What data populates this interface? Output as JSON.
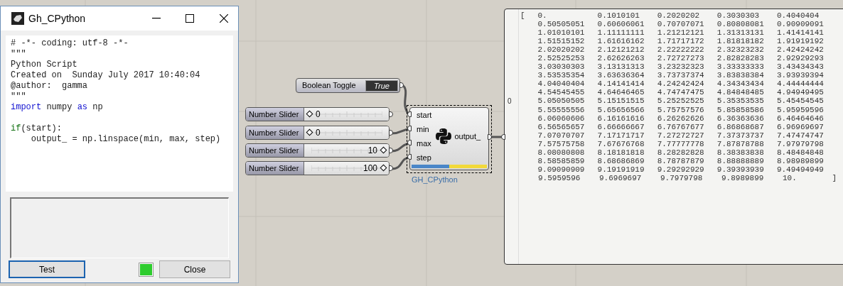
{
  "editor": {
    "title": "Gh_CPython",
    "code_lines": [
      [
        {
          "text": "# -*- coding: utf-8 -*-",
          "kind": "plain"
        }
      ],
      [
        {
          "text": "\"\"\"",
          "kind": "plain"
        }
      ],
      [
        {
          "text": "Python Script",
          "kind": "plain"
        }
      ],
      [
        {
          "text": "Created on  Sunday July 2017 10:40:04",
          "kind": "plain"
        }
      ],
      [
        {
          "text": "@author:  gamma",
          "kind": "plain"
        }
      ],
      [
        {
          "text": "\"\"\"",
          "kind": "plain"
        }
      ],
      [
        {
          "text": "import",
          "kind": "keyword"
        },
        {
          "text": " numpy ",
          "kind": "plain"
        },
        {
          "text": "as",
          "kind": "keyword"
        },
        {
          "text": " np",
          "kind": "plain"
        }
      ],
      {
        "blank_before": true,
        "tokens": [
          {
            "text": "if",
            "kind": "control"
          },
          {
            "text": "(start):",
            "kind": "plain"
          }
        ]
      },
      [
        {
          "text": "    output_ = np.linspace(min, max, step)",
          "kind": "plain"
        }
      ]
    ],
    "run_ok": true,
    "buttons": [
      {
        "label": "Test",
        "focused": true
      },
      {
        "label": "Close",
        "focused": false
      }
    ]
  },
  "toggle": {
    "label": "Boolean Toggle",
    "value": "True"
  },
  "sliders": [
    {
      "label": "Number Slider",
      "value": "0",
      "level": 0
    },
    {
      "label": "Number Slider",
      "value": "0",
      "level": 0
    },
    {
      "label": "Number Slider",
      "value": "10",
      "level": 1
    },
    {
      "label": "Number Slider",
      "value": "100",
      "level": 1
    }
  ],
  "component": {
    "name": "GH_CPython",
    "inputs": [
      "start",
      "min",
      "max",
      "step"
    ],
    "outputs": [
      "output_"
    ],
    "selected": true
  },
  "panel": {
    "index": "0",
    "open": "[",
    "close": "]",
    "rows": [
      [
        "0.",
        "0.1010101",
        "0.2020202",
        "0.3030303",
        "0.4040404"
      ],
      [
        "0.50505051",
        "0.60606061",
        "0.70707071",
        "0.80808081",
        "0.90909091"
      ],
      [
        "1.01010101",
        "1.11111111",
        "1.21212121",
        "1.31313131",
        "1.41414141"
      ],
      [
        "1.51515152",
        "1.61616162",
        "1.71717172",
        "1.81818182",
        "1.91919192"
      ],
      [
        "2.02020202",
        "2.12121212",
        "2.22222222",
        "2.32323232",
        "2.42424242"
      ],
      [
        "2.52525253",
        "2.62626263",
        "2.72727273",
        "2.82828283",
        "2.92929293"
      ],
      [
        "3.03030303",
        "3.13131313",
        "3.23232323",
        "3.33333333",
        "3.43434343"
      ],
      [
        "3.53535354",
        "3.63636364",
        "3.73737374",
        "3.83838384",
        "3.93939394"
      ],
      [
        "4.04040404",
        "4.14141414",
        "4.24242424",
        "4.34343434",
        "4.44444444"
      ],
      [
        "4.54545455",
        "4.64646465",
        "4.74747475",
        "4.84848485",
        "4.94949495"
      ],
      [
        "5.05050505",
        "5.15151515",
        "5.25252525",
        "5.35353535",
        "5.45454545"
      ],
      [
        "5.55555556",
        "5.65656566",
        "5.75757576",
        "5.85858586",
        "5.95959596"
      ],
      [
        "6.06060606",
        "6.16161616",
        "6.26262626",
        "6.36363636",
        "6.46464646"
      ],
      [
        "6.56565657",
        "6.66666667",
        "6.76767677",
        "6.86868687",
        "6.96969697"
      ],
      [
        "7.07070707",
        "7.17171717",
        "7.27272727",
        "7.37373737",
        "7.47474747"
      ],
      [
        "7.57575758",
        "7.67676768",
        "7.77777778",
        "7.87878788",
        "7.97979798"
      ],
      [
        "8.08080808",
        "8.18181818",
        "8.28282828",
        "8.38383838",
        "8.48484848"
      ],
      [
        "8.58585859",
        "8.68686869",
        "8.78787879",
        "8.88888889",
        "8.98989899"
      ],
      [
        "9.09090909",
        "9.19191919",
        "9.29292929",
        "9.39393939",
        "9.49494949"
      ],
      [
        "9.5959596",
        "9.6969697",
        "9.7979798",
        "9.8989899",
        "10."
      ]
    ]
  }
}
